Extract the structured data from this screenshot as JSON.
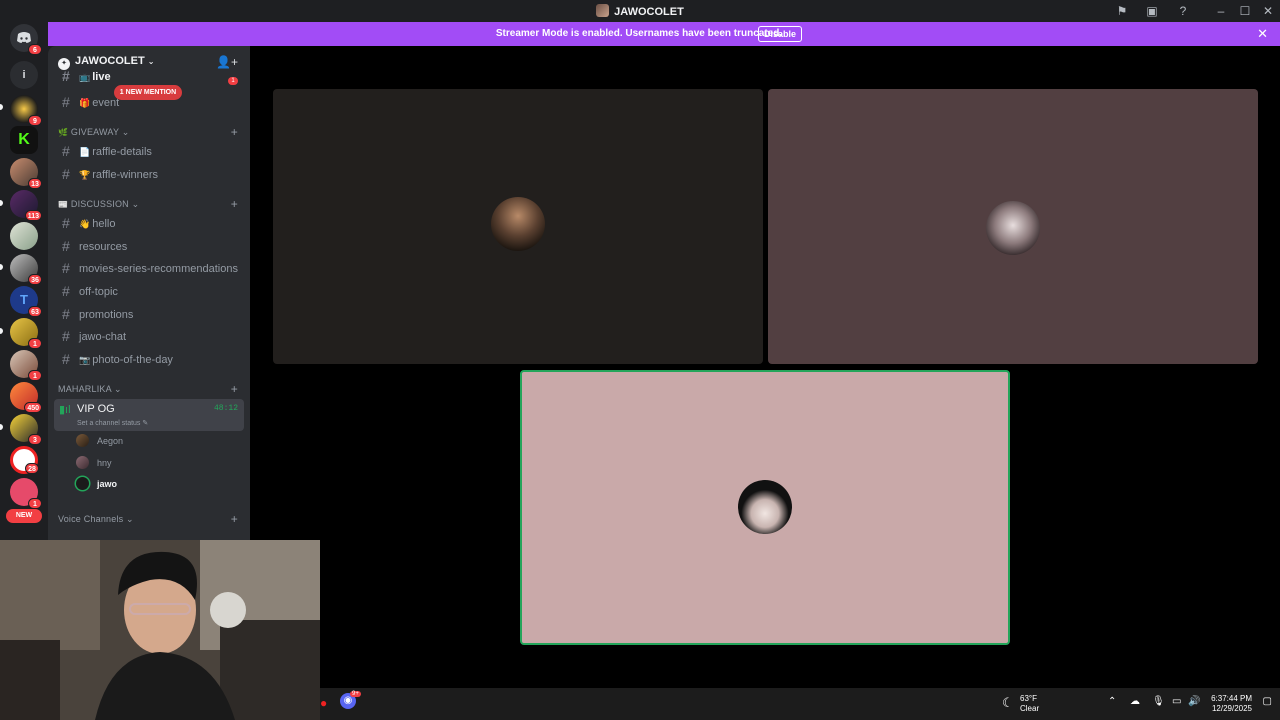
{
  "window": {
    "title": "JAWOCOLET"
  },
  "banner": {
    "text": "Streamer Mode is enabled. Usernames have been truncated.",
    "button": "Disable"
  },
  "guilds": {
    "home_badge": "6",
    "info_label": "i",
    "badges": [
      "9",
      "",
      "13",
      "113",
      "",
      "36",
      "63",
      "1",
      "1",
      "450",
      "3",
      "28",
      "1"
    ],
    "new_label": "NEW"
  },
  "server": {
    "name": "JAWOCOLET"
  },
  "channels": {
    "live": "live",
    "event": "event",
    "mention_pill": "1 NEW MENTION",
    "live_unread": "1",
    "giveaway_cat": "GIVEAWAY",
    "raffle_details": "raffle-details",
    "raffle_winners": "raffle-winners",
    "discussion_cat": "DISCUSSION",
    "hello": "hello",
    "resources": "resources",
    "movies": "movies-series-recommendations",
    "offtopic": "off-topic",
    "promotions": "promotions",
    "jawochat": "jawo-chat",
    "photo": "photo-of-the-day",
    "maharlika_cat": "MAHARLIKA",
    "voice_channels_cat": "Voice Channels"
  },
  "voice": {
    "channel": "VIP OG",
    "time": "48:12",
    "status": "Set a channel status",
    "users": [
      "Aegon",
      "hny",
      "jawo"
    ]
  },
  "taskbar": {
    "weather_temp": "63°F",
    "weather_desc": "Clear",
    "time": "6:37:44 PM",
    "date": "12/29/2025",
    "discord_badge": "9+"
  },
  "colors": {
    "banner": "#a24cf6",
    "tile1": "#221f1d",
    "tile2": "#523f41",
    "tile3": "#c9a9a9",
    "speaking": "#23a55a"
  }
}
